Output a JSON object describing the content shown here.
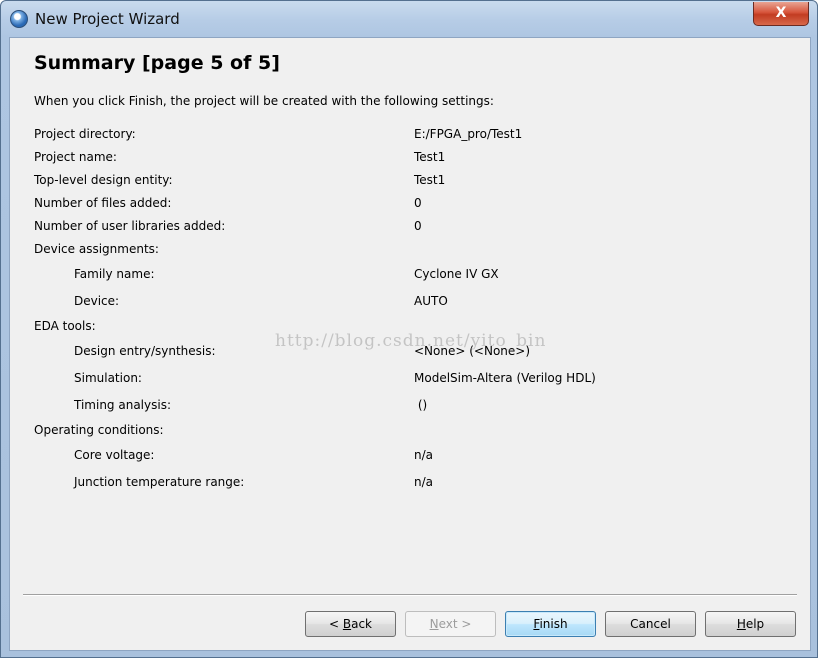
{
  "window": {
    "title": "New Project Wizard",
    "close_glyph": "X"
  },
  "page": {
    "heading": "Summary [page 5 of 5]",
    "intro": "When you click Finish, the project will be created with the following settings:"
  },
  "settings": {
    "project_directory": {
      "label": "Project directory:",
      "value": "E:/FPGA_pro/Test1"
    },
    "project_name": {
      "label": "Project name:",
      "value": "Test1"
    },
    "top_level_entity": {
      "label": "Top-level design entity:",
      "value": "Test1"
    },
    "files_added": {
      "label": "Number of files added:",
      "value": "0"
    },
    "user_libraries_added": {
      "label": "Number of user libraries added:",
      "value": "0"
    },
    "device_assignments": {
      "label": "Device assignments:"
    },
    "family_name": {
      "label": "Family name:",
      "value": "Cyclone IV GX"
    },
    "device": {
      "label": "Device:",
      "value": "AUTO"
    },
    "eda_tools": {
      "label": "EDA tools:"
    },
    "design_entry": {
      "label": "Design entry/synthesis:",
      "value": "<None> (<None>)"
    },
    "simulation": {
      "label": "Simulation:",
      "value": "ModelSim-Altera (Verilog HDL)"
    },
    "timing_analysis": {
      "label": "Timing analysis:",
      "value": " ()"
    },
    "operating_conditions": {
      "label": "Operating conditions:"
    },
    "core_voltage": {
      "label": "Core voltage:",
      "value": "n/a"
    },
    "junction_temp": {
      "label": "Junction temperature range:",
      "value": "n/a"
    }
  },
  "watermark": "http://blog.csdn.net/yito_bin",
  "buttons": {
    "back": {
      "prefix": "< ",
      "mnemonic": "B",
      "rest": "ack"
    },
    "next": {
      "mnemonic": "N",
      "rest": "ext >"
    },
    "finish": {
      "mnemonic": "F",
      "rest": "inish"
    },
    "cancel": {
      "label": "Cancel"
    },
    "help": {
      "mnemonic": "H",
      "rest": "elp"
    }
  },
  "colors": {
    "title_bar": "#b6cce6",
    "client_bg": "#f0f0f0",
    "close_red": "#c23c22",
    "default_button": "#bee6fd"
  }
}
